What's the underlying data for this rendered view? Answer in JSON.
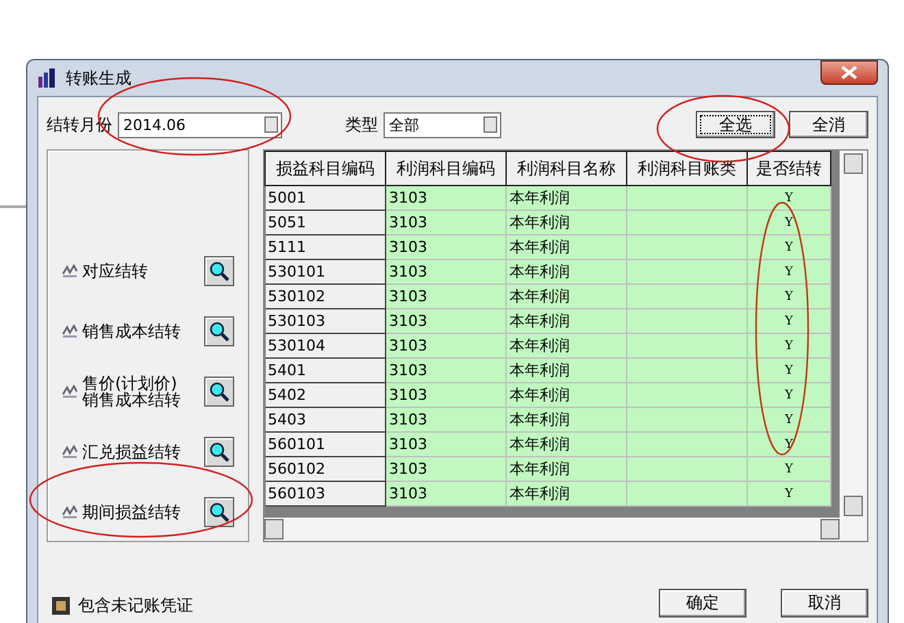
{
  "window": {
    "title": "转账生成"
  },
  "month": {
    "label": "结转月份",
    "value": "2014.06"
  },
  "type": {
    "label": "类型",
    "value": "全部"
  },
  "top_buttons": [
    "全选",
    "全消"
  ],
  "transfer_items": [
    {
      "label": "对应结转"
    },
    {
      "label": "销售成本结转"
    },
    {
      "label": "售价(计划价)\n销售成本结转"
    },
    {
      "label": "汇兑损益结转"
    },
    {
      "label": "期间损益结转"
    }
  ],
  "table": {
    "columns": [
      "损益科目编码",
      "利润科目编码",
      "利润科目名称",
      "利润科目账类",
      "是否结转"
    ],
    "rows": [
      [
        "5001",
        "3103",
        "本年利润",
        "",
        "Y"
      ],
      [
        "5051",
        "3103",
        "本年利润",
        "",
        "Y"
      ],
      [
        "5111",
        "3103",
        "本年利润",
        "",
        "Y"
      ],
      [
        "530101",
        "3103",
        "本年利润",
        "",
        "Y"
      ],
      [
        "530102",
        "3103",
        "本年利润",
        "",
        "Y"
      ],
      [
        "530103",
        "3103",
        "本年利润",
        "",
        "Y"
      ],
      [
        "530104",
        "3103",
        "本年利润",
        "",
        "Y"
      ],
      [
        "5401",
        "3103",
        "本年利润",
        "",
        "Y"
      ],
      [
        "5402",
        "3103",
        "本年利润",
        "",
        "Y"
      ],
      [
        "5403",
        "3103",
        "本年利润",
        "",
        "Y"
      ],
      [
        "560101",
        "3103",
        "本年利润",
        "",
        "Y"
      ],
      [
        "560102",
        "3103",
        "本年利润",
        "",
        "Y"
      ],
      [
        "560103",
        "3103",
        "本年利润",
        "",
        "Y"
      ]
    ]
  },
  "include_unposted": {
    "label": "包含未记账凭证"
  },
  "bottom_buttons": [
    "确定",
    "取消"
  ]
}
